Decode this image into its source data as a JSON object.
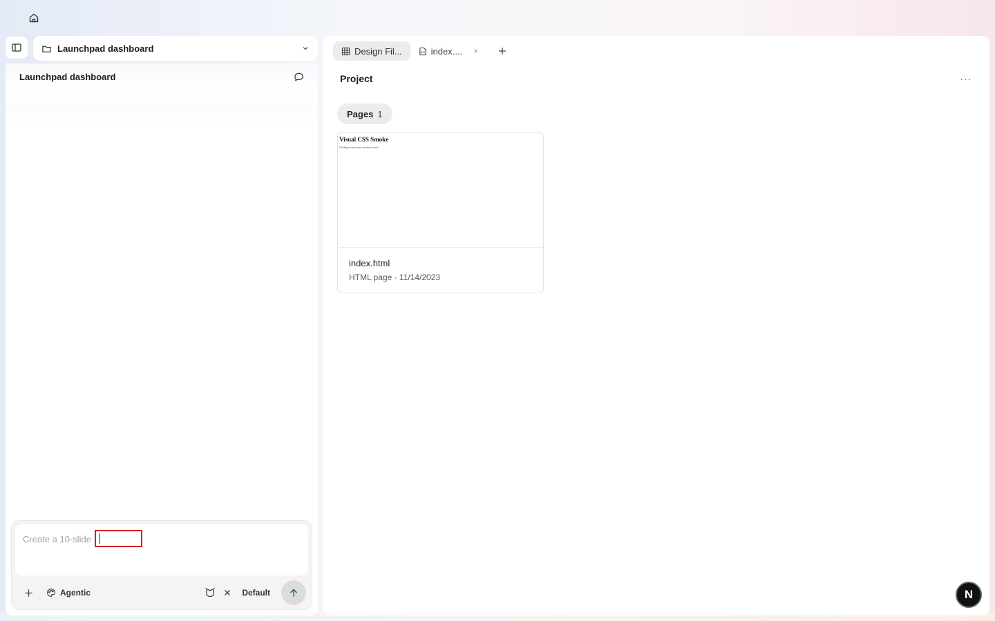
{
  "header": {
    "home_icon": "home-icon"
  },
  "sidebar": {
    "toggle_icon": "sidebar-toggle-icon",
    "project_selector": {
      "folder_icon": "folder-icon",
      "label": "Launchpad dashboard",
      "chevron_icon": "chevron-down-icon"
    },
    "panel": {
      "title": "Launchpad dashboard",
      "chat_icon": "chat-bubble-icon"
    }
  },
  "composer": {
    "placeholder": "Create a 10-slide",
    "value": "",
    "add_icon": "plus-icon",
    "mode": {
      "icon": "palette-icon",
      "label": "Agentic"
    },
    "agent_icon": "agent-icon",
    "clear_icon": "close-icon",
    "model_label": "Default",
    "send_icon": "arrow-up-icon"
  },
  "main": {
    "tabs": [
      {
        "label": "Design Fil...",
        "icon": "grid-icon",
        "active": true
      },
      {
        "label": "index....",
        "icon": "file-code-icon",
        "active": false,
        "close": "×"
      }
    ],
    "add_tab_icon": "plus-icon",
    "title": "Project",
    "more_label": "···",
    "pages_chip": {
      "label": "Pages",
      "count": "1"
    },
    "page_cards": [
      {
        "thumb_title": "Visual CSS Smoke",
        "thumb_subtitle": "Workspace preview contains frame.",
        "name": "index.html",
        "info": "HTML page · 11/14/2023"
      }
    ]
  },
  "user": {
    "avatar_letter": "N"
  },
  "colors": {
    "accent_send": "#2e7d32",
    "highlight_box": "#d62020",
    "avatar_bg": "#111111"
  }
}
